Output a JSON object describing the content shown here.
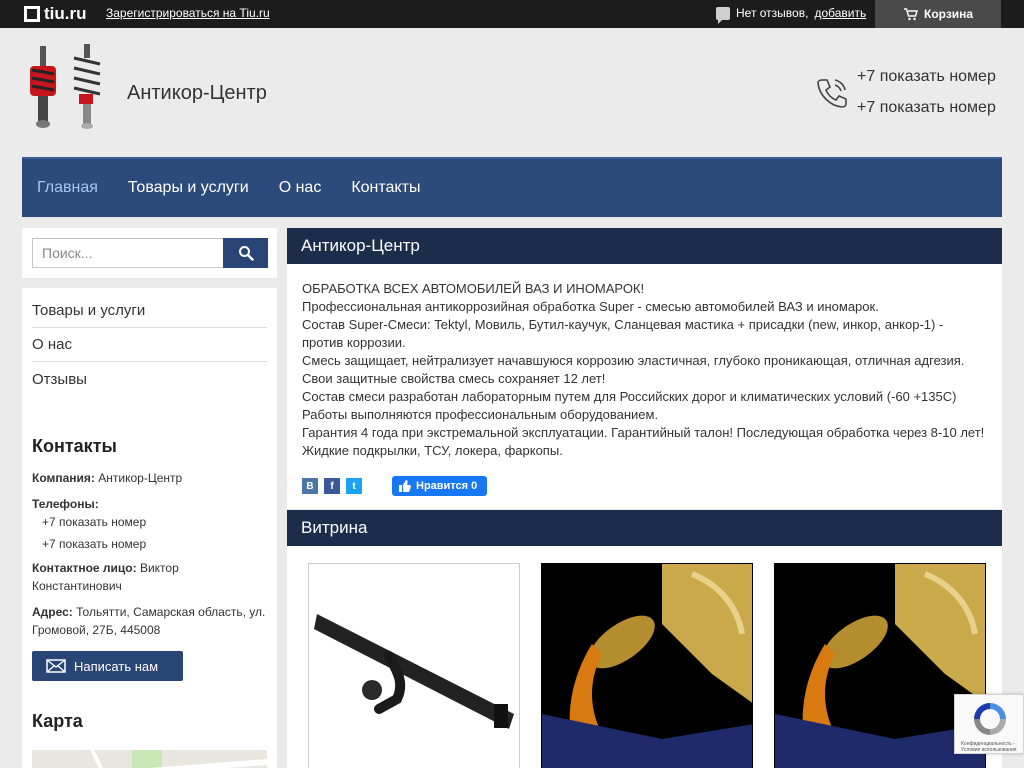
{
  "topbar": {
    "logo": "tiu.ru",
    "register_link": "Зарегистрироваться на Tiu.ru",
    "reviews_text": "Нет отзывов,",
    "reviews_add": "добавить",
    "cart": "Корзина"
  },
  "header": {
    "company": "Антикор-Центр",
    "phones": [
      "+7 показать номер",
      "+7 показать номер"
    ]
  },
  "nav": {
    "items": [
      "Главная",
      "Товары и услуги",
      "О нас",
      "Контакты"
    ],
    "active": "Главная"
  },
  "search": {
    "placeholder": "Поиск..."
  },
  "sidebar": {
    "menu": [
      "Товары и услуги",
      "О нас",
      "Отзывы"
    ],
    "contacts_title": "Контакты",
    "company_label": "Компания:",
    "company_value": "Антикор-Центр",
    "phones_label": "Телефоны:",
    "phones": [
      "+7 показать номер",
      "+7 показать номер"
    ],
    "person_label": "Контактное лицо:",
    "person_value": "Виктор Константинович",
    "address_label": "Адрес:",
    "address_value": "Тольятти, Самарская область, ул. Громовой, 27Б, 445008",
    "write_button": "Написать нам",
    "map_title": "Карта"
  },
  "main": {
    "title": "Антикор-Центр",
    "lines": [
      "ОБРАБОТКА ВСЕХ АВТОМОБИЛЕЙ ВАЗ И ИНОМАРОК!",
      "Профессиональная антикоррозийная обработка Super - смесью автомобилей ВАЗ и иномарок.",
      "Состав Super-Смеси: Tektyl, Мовиль, Бутил-каучук, Сланцевая мастика + присадки (new, инкор, анкор-1) -",
      "против коррозии.",
      "Смесь защищает, нейтрализует начавшуюся коррозию эластичная, глубоко проникающая, отличная адгезия.",
      "Свои защитные свойства смесь сохраняет 12 лет!",
      "Состав смеси разработан лабораторным путем для Российских дорог и климатических условий (-60 +135С)",
      "Работы выполняются профессиональным оборудованием.",
      "Гарантия 4 года при экстремальной эксплуатации. Гарантийный талон! Последующая обработка через 8-10 лет!",
      "Жидкие подкрылки, ТСУ, локера, фаркопы."
    ],
    "like_label": "Нравится 0",
    "share": [
      "В",
      "f",
      "t"
    ]
  },
  "vitrina": {
    "title": "Витрина"
  },
  "recaptcha": {
    "text": "Конфиденциальность - Условия использования"
  },
  "colors": {
    "nav": "#2c4a7c",
    "heading_bar": "#1c2d4c",
    "button": "#284576",
    "facebook": "#1877f2"
  }
}
